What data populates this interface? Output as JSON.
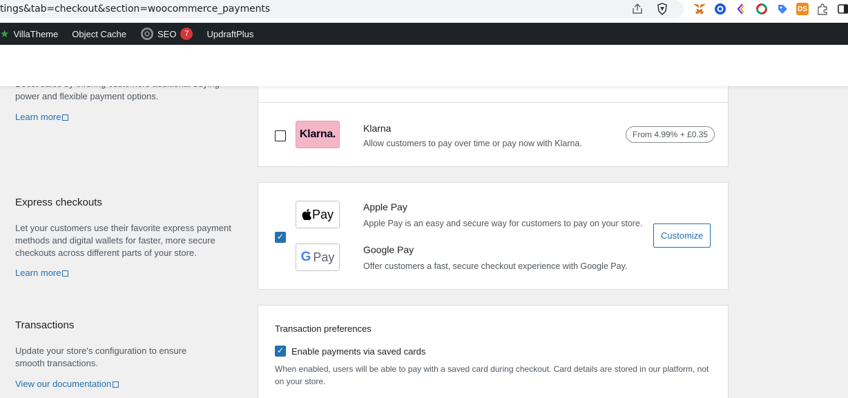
{
  "browser": {
    "url": "tings&tab=checkout&section=woocommerce_payments",
    "icons": [
      "share-icon",
      "brave-shield-icon"
    ],
    "extensions": [
      "metamask-icon",
      "gear-extension-icon",
      "bracket-extension-icon",
      "ring-extension-icon",
      "tag-extension-icon",
      "ds-extension-icon",
      "puzzle-icon",
      "sidebar-icon"
    ],
    "ds_label": "DS"
  },
  "adminbar": {
    "villatheme": "VillaTheme",
    "object_cache": "Object Cache",
    "seo": "SEO",
    "seo_count": "7",
    "updraft": "UpdraftPlus"
  },
  "bnpl": {
    "desc_partial": "Boost sales by offering customers additional buying power and flexible payment options.",
    "desc_line2": "power and flexible payment options.",
    "learn_more": "Learn more"
  },
  "klarna": {
    "logo": "Klarna.",
    "title": "Klarna",
    "description": "Allow customers to pay over time or pay now with Klarna.",
    "fee": "From 4.99% + £0.35",
    "enabled": false
  },
  "express": {
    "title": "Express checkouts",
    "description": "Let your customers use their favorite express payment methods and digital wallets for faster, more secure checkouts across different parts of your store.",
    "learn_more": "Learn more",
    "enabled": true,
    "apple_pay": {
      "logo": "Pay",
      "title": "Apple Pay",
      "description": "Apple Pay is an easy and secure way for customers to pay on your store."
    },
    "google_pay": {
      "logo": "Pay",
      "title": "Google Pay",
      "description": "Offer customers a fast, secure checkout experience with Google Pay."
    },
    "customize": "Customize"
  },
  "transactions": {
    "title": "Transactions",
    "description": "Update your store's configuration to ensure smooth transactions.",
    "doc_link": "View our documentation",
    "preferences_title": "Transaction preferences",
    "saved_cards_label": "Enable payments via saved cards",
    "saved_cards_enabled": true,
    "saved_cards_help": "When enabled, users will be able to pay with a saved card during checkout. Card details are stored in our platform, not on your store."
  },
  "colors": {
    "admin_bar": "#1d2327",
    "accent": "#2271b1",
    "badge": "#d63638",
    "klarna_pink": "#f4b6c7"
  }
}
